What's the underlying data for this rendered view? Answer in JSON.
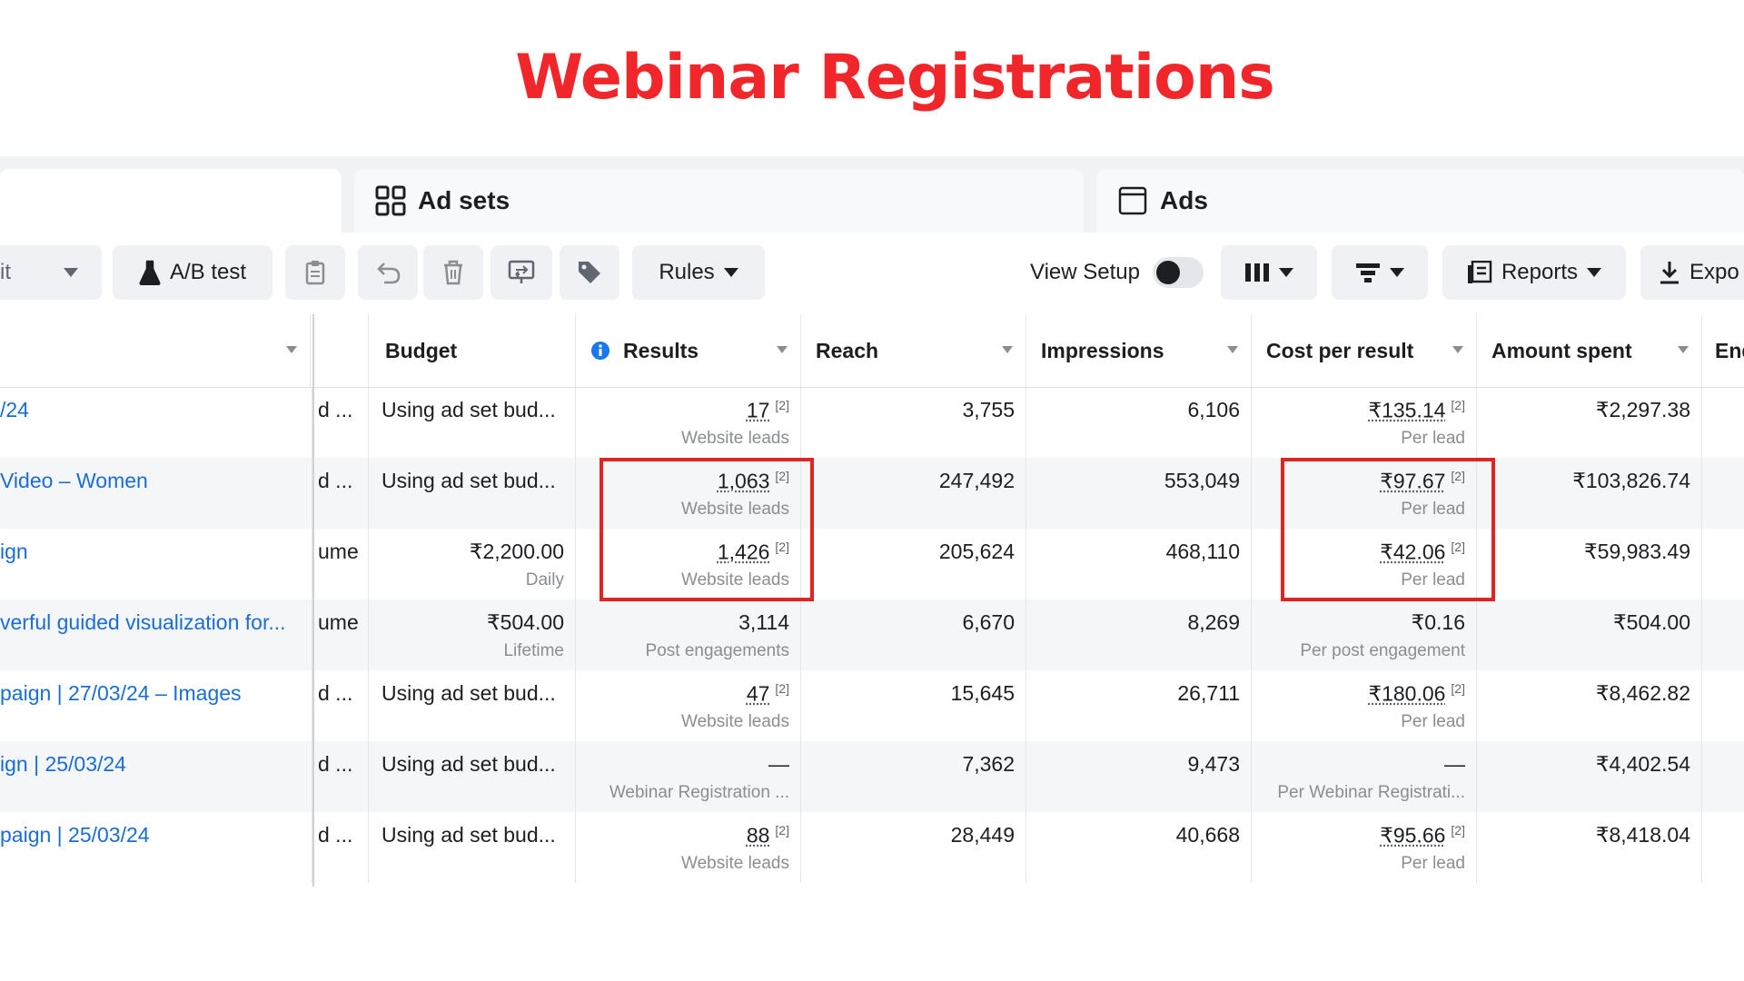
{
  "headline": "Webinar Registrations",
  "tabs": [
    {
      "label": ""
    },
    {
      "label": "Ad sets",
      "icon": "grid-icon"
    },
    {
      "label": "Ads",
      "icon": "ad-frame-icon"
    }
  ],
  "toolbar": {
    "edit_label": "it",
    "ab_test_label": "A/B test",
    "rules_label": "Rules",
    "view_setup_label": "View Setup",
    "reports_label": "Reports",
    "export_label": "Expo"
  },
  "columns": {
    "budget": "Budget",
    "results": "Results",
    "reach": "Reach",
    "impressions": "Impressions",
    "cost_per_result": "Cost per result",
    "amount_spent": "Amount spent",
    "ends": "End"
  },
  "rows": [
    {
      "name": "/24",
      "bid": "d ...",
      "budget": "Using ad set bud...",
      "budget_sub": "",
      "results": "17",
      "results_fn": "[2]",
      "results_sub": "Website leads",
      "reach": "3,755",
      "impressions": "6,106",
      "cost": "₹135.14",
      "cost_fn": "[2]",
      "cost_sub": "Per lead",
      "spent": "₹2,297.38"
    },
    {
      "name": "Video – Women",
      "bid": "d ...",
      "budget": "Using ad set bud...",
      "budget_sub": "",
      "results": "1,063",
      "results_fn": "[2]",
      "results_sub": "Website leads",
      "reach": "247,492",
      "impressions": "553,049",
      "cost": "₹97.67",
      "cost_fn": "[2]",
      "cost_sub": "Per lead",
      "spent": "₹103,826.74"
    },
    {
      "name": "ign",
      "bid": "ume",
      "budget": "₹2,200.00",
      "budget_sub": "Daily",
      "results": "1,426",
      "results_fn": "[2]",
      "results_sub": "Website leads",
      "reach": "205,624",
      "impressions": "468,110",
      "cost": "₹42.06",
      "cost_fn": "[2]",
      "cost_sub": "Per lead",
      "spent": "₹59,983.49"
    },
    {
      "name": "verful guided visualization for...",
      "bid": "ume",
      "budget": "₹504.00",
      "budget_sub": "Lifetime",
      "results": "3,114",
      "results_fn": "",
      "results_sub": "Post engagements",
      "reach": "6,670",
      "impressions": "8,269",
      "cost": "₹0.16",
      "cost_fn": "",
      "cost_sub": "Per post engagement",
      "spent": "₹504.00"
    },
    {
      "name": "paign | 27/03/24 – Images",
      "bid": "d ...",
      "budget": "Using ad set bud...",
      "budget_sub": "",
      "results": "47",
      "results_fn": "[2]",
      "results_sub": "Website leads",
      "reach": "15,645",
      "impressions": "26,711",
      "cost": "₹180.06",
      "cost_fn": "[2]",
      "cost_sub": "Per lead",
      "spent": "₹8,462.82"
    },
    {
      "name": "ign | 25/03/24",
      "bid": "d ...",
      "budget": "Using ad set bud...",
      "budget_sub": "",
      "results": "—",
      "results_fn": "",
      "results_sub": "Webinar Registration ...",
      "reach": "7,362",
      "impressions": "9,473",
      "cost": "—",
      "cost_fn": "",
      "cost_sub": "Per Webinar Registrati...",
      "spent": "₹4,402.54"
    },
    {
      "name": "paign | 25/03/24",
      "bid": "d ...",
      "budget": "Using ad set bud...",
      "budget_sub": "",
      "results": "88",
      "results_fn": "[2]",
      "results_sub": "Website leads",
      "reach": "28,449",
      "impressions": "40,668",
      "cost": "₹95.66",
      "cost_fn": "[2]",
      "cost_sub": "Per lead",
      "spent": "₹8,418.04"
    }
  ],
  "colors": {
    "headline": "#f0262a",
    "link": "#1a6dd9",
    "highlight_box": "#e02424",
    "info": "#1877f2"
  }
}
